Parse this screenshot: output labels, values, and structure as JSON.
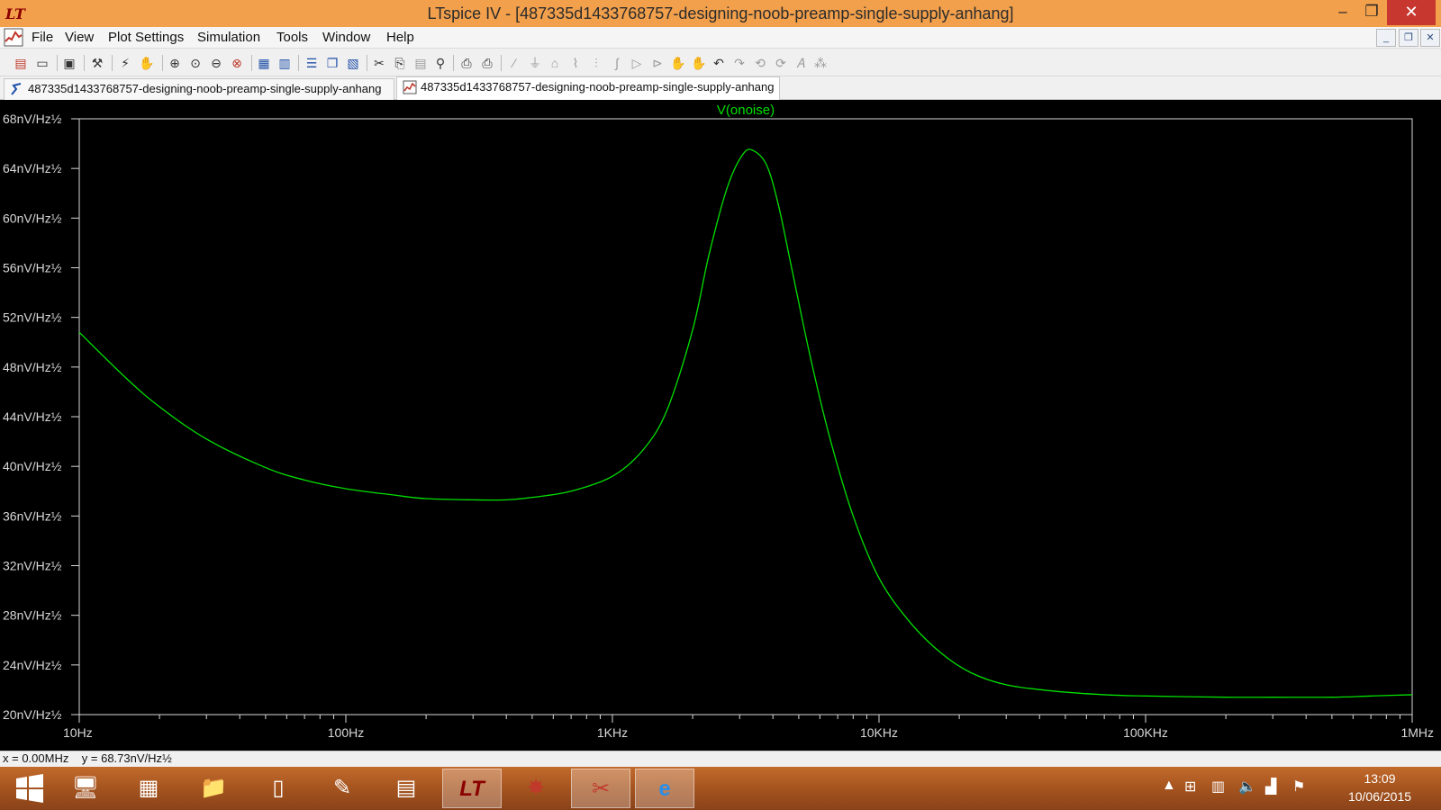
{
  "window": {
    "title": "LTspice IV - [487335d1433768757-designing-noob-preamp-single-supply-anhang]",
    "controls": {
      "minimize": "–",
      "maximize": "❐",
      "close": "✕"
    }
  },
  "menu": {
    "items": [
      "File",
      "View",
      "Plot Settings",
      "Simulation",
      "Tools",
      "Window",
      "Help"
    ]
  },
  "tabs": [
    {
      "label": "487335d1433768757-designing-noob-preamp-single-supply-anhang",
      "icon": "schematic-icon",
      "active": false
    },
    {
      "label": "487335d1433768757-designing-noob-preamp-single-supply-anhang",
      "icon": "waveform-icon",
      "active": true
    }
  ],
  "colors": {
    "trace": "#00e000",
    "plot_bg": "#000000",
    "axis": "#d8d8d8",
    "title_bar": "#f2a04c"
  },
  "chart_data": {
    "type": "line",
    "title": "V(onoise)",
    "x_scale": "log",
    "xlim": [
      10,
      1000000
    ],
    "ylim": [
      20,
      68
    ],
    "x_ticks": [
      {
        "value": 10,
        "label": "10Hz"
      },
      {
        "value": 100,
        "label": "100Hz"
      },
      {
        "value": 1000,
        "label": "1KHz"
      },
      {
        "value": 10000,
        "label": "10KHz"
      },
      {
        "value": 100000,
        "label": "100KHz"
      },
      {
        "value": 1000000,
        "label": "1MHz"
      }
    ],
    "y_ticks": [
      {
        "value": 68,
        "label": "68nV/Hz½"
      },
      {
        "value": 64,
        "label": "64nV/Hz½"
      },
      {
        "value": 60,
        "label": "60nV/Hz½"
      },
      {
        "value": 56,
        "label": "56nV/Hz½"
      },
      {
        "value": 52,
        "label": "52nV/Hz½"
      },
      {
        "value": 48,
        "label": "48nV/Hz½"
      },
      {
        "value": 44,
        "label": "44nV/Hz½"
      },
      {
        "value": 40,
        "label": "40nV/Hz½"
      },
      {
        "value": 36,
        "label": "36nV/Hz½"
      },
      {
        "value": 32,
        "label": "32nV/Hz½"
      },
      {
        "value": 28,
        "label": "28nV/Hz½"
      },
      {
        "value": 24,
        "label": "24nV/Hz½"
      },
      {
        "value": 20,
        "label": "20nV/Hz½"
      }
    ],
    "series": [
      {
        "name": "V(onoise)",
        "x": [
          10,
          15,
          20,
          30,
          50,
          70,
          100,
          150,
          200,
          300,
          400,
          500,
          700,
          1000,
          1300,
          1600,
          2000,
          2300,
          2700,
          3100,
          3400,
          3800,
          4200,
          4700,
          5500,
          6500,
          8000,
          10000,
          13000,
          17000,
          22000,
          30000,
          45000,
          70000,
          100000,
          200000,
          300000,
          500000,
          700000,
          1000000
        ],
        "y": [
          50.8,
          47.1,
          44.8,
          42.2,
          39.9,
          38.9,
          38.2,
          37.7,
          37.4,
          37.3,
          37.3,
          37.5,
          38.0,
          39.2,
          41.3,
          44.5,
          51.0,
          57.0,
          62.5,
          65.2,
          65.4,
          64.2,
          61.0,
          56.0,
          49.0,
          42.5,
          36.0,
          31.0,
          27.5,
          25.0,
          23.4,
          22.4,
          21.9,
          21.6,
          21.5,
          21.4,
          21.4,
          21.4,
          21.5,
          21.6
        ]
      }
    ]
  },
  "status": {
    "text": "x = 0.00MHz    y = 68.73nV/Hz½"
  },
  "taskbar": {
    "time": "13:09",
    "date": "10/06/2015"
  }
}
